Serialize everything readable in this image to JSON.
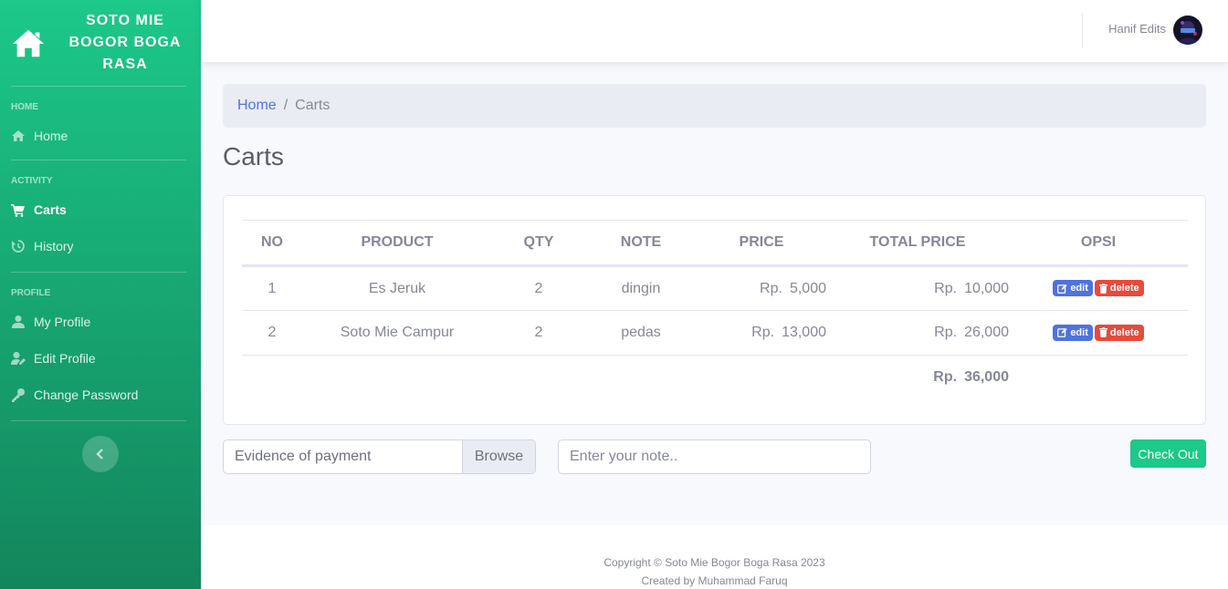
{
  "sidebar": {
    "brand": "SOTO MIE BOGOR BOGA RASA",
    "sections": {
      "home": "HOME",
      "activity": "ACTIVITY",
      "profile": "PROFILE"
    },
    "items": {
      "home": "Home",
      "carts": "Carts",
      "history": "History",
      "my_profile": "My Profile",
      "edit_profile": "Edit Profile",
      "change_password": "Change Password"
    }
  },
  "topbar": {
    "user_name": "Hanif Edits"
  },
  "breadcrumb": {
    "home": "Home",
    "separator": "/",
    "current": "Carts"
  },
  "page": {
    "title": "Carts"
  },
  "table": {
    "headers": {
      "no": "NO",
      "product": "PRODUCT",
      "qty": "QTY",
      "note": "NOTE",
      "price": "PRICE",
      "total_price": "TOTAL PRICE",
      "opsi": "OPSI"
    },
    "currency": "Rp.",
    "rows": [
      {
        "no": "1",
        "product": "Es Jeruk",
        "qty": "2",
        "note": "dingin",
        "price": "5,000",
        "total": "10,000"
      },
      {
        "no": "2",
        "product": "Soto Mie Campur",
        "qty": "2",
        "note": "pedas",
        "price": "13,000",
        "total": "26,000"
      }
    ],
    "grand_total": "36,000",
    "edit_label": "edit",
    "delete_label": "delete"
  },
  "form": {
    "file_placeholder": "Evidence of payment",
    "browse_label": "Browse",
    "note_placeholder": "Enter your note..",
    "checkout_label": "Check Out"
  },
  "footer": {
    "copyright": "Copyright © Soto Mie Bogor Boga Rasa 2023",
    "credit": "Created by Muhammad Faruq"
  },
  "colors": {
    "primary": "#4e73df",
    "success": "#1cc88a",
    "danger": "#e74a3b"
  }
}
